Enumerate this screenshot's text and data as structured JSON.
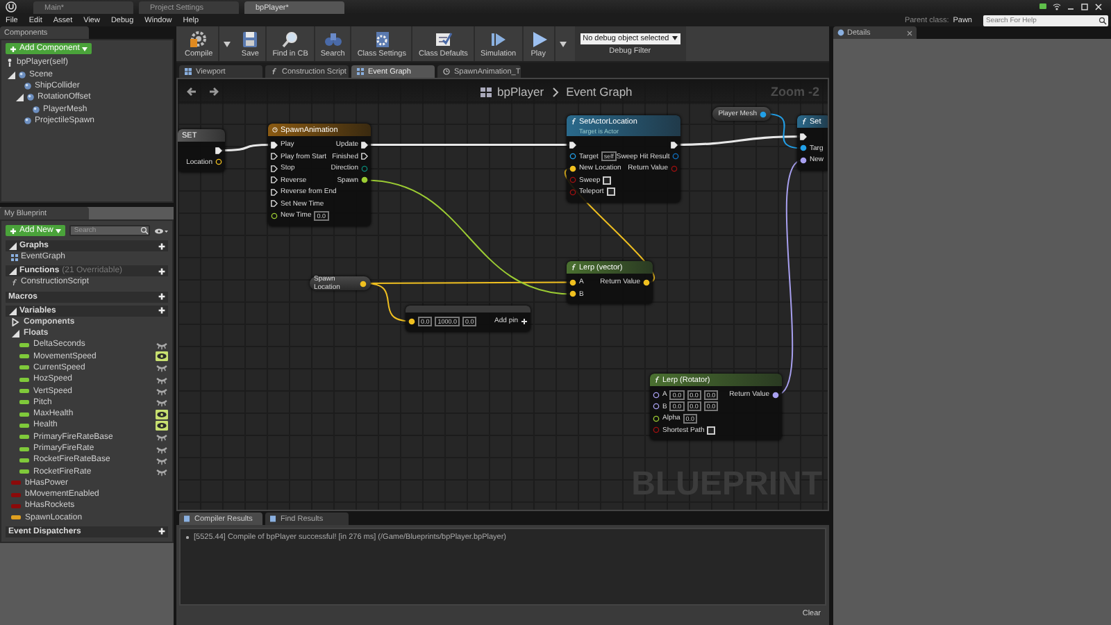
{
  "title_tabs": [
    {
      "label": "Main*",
      "selected": false
    },
    {
      "label": "Project Settings",
      "selected": false
    },
    {
      "label": "bpPlayer*",
      "selected": true
    }
  ],
  "menu": [
    "File",
    "Edit",
    "Asset",
    "View",
    "Debug",
    "Window",
    "Help"
  ],
  "parent_class": {
    "label": "Parent class:",
    "value": "Pawn"
  },
  "help_search": {
    "placeholder": "Search For Help"
  },
  "components_panel": {
    "tab": "Components",
    "add_button": "Add Component",
    "self_item": "bpPlayer(self)",
    "tree": [
      {
        "label": "Scene",
        "expanded": true,
        "children": [
          {
            "label": "ShipCollider"
          },
          {
            "label": "RotationOffset",
            "expanded": true,
            "children": [
              {
                "label": "PlayerMesh"
              }
            ]
          },
          {
            "label": "ProjectileSpawn"
          }
        ]
      }
    ]
  },
  "my_blueprint": {
    "tab": "My Blueprint",
    "add_button": "Add New",
    "search": {
      "placeholder": "Search"
    },
    "sections": [
      {
        "title": "Graphs",
        "expanded": true,
        "items": [
          {
            "label": "EventGraph",
            "kind": "graph"
          }
        ]
      },
      {
        "title": "Functions",
        "note": "(21 Overridable)",
        "expanded": true,
        "items": [
          {
            "label": "ConstructionScript",
            "kind": "function"
          }
        ]
      },
      {
        "title": "Macros"
      },
      {
        "title": "Variables",
        "expanded": true,
        "items": [
          {
            "label": "Components",
            "kind": "category",
            "expanded": false
          },
          {
            "label": "Floats",
            "kind": "category",
            "expanded": true,
            "children": [
              {
                "label": "DeltaSeconds",
                "kind": "variable",
                "color": "#7fc93a",
                "public": false
              },
              {
                "label": "MovementSpeed",
                "kind": "variable",
                "color": "#7fc93a",
                "public": true
              },
              {
                "label": "CurrentSpeed",
                "kind": "variable",
                "color": "#7fc93a",
                "public": false
              },
              {
                "label": "HozSpeed",
                "kind": "variable",
                "color": "#7fc93a",
                "public": false
              },
              {
                "label": "VertSpeed",
                "kind": "variable",
                "color": "#7fc93a",
                "public": false
              },
              {
                "label": "Pitch",
                "kind": "variable",
                "color": "#7fc93a",
                "public": false
              },
              {
                "label": "MaxHealth",
                "kind": "variable",
                "color": "#7fc93a",
                "public": true
              },
              {
                "label": "Health",
                "kind": "variable",
                "color": "#7fc93a",
                "public": true
              },
              {
                "label": "PrimaryFireRateBase",
                "kind": "variable",
                "color": "#7fc93a",
                "public": false
              },
              {
                "label": "PrimaryFireRate",
                "kind": "variable",
                "color": "#7fc93a",
                "public": false
              },
              {
                "label": "RocketFireRateBase",
                "kind": "variable",
                "color": "#7fc93a",
                "public": false
              },
              {
                "label": "RocketFireRate",
                "kind": "variable",
                "color": "#7fc93a",
                "public": false
              }
            ]
          },
          {
            "label": "bHasPower",
            "kind": "variable",
            "color": "#8c0a0a"
          },
          {
            "label": "bMovementEnabled",
            "kind": "variable",
            "color": "#8c0a0a"
          },
          {
            "label": "bHasRockets",
            "kind": "variable",
            "color": "#8c0a0a"
          },
          {
            "label": "SpawnLocation",
            "kind": "variable",
            "color": "#e0a020"
          }
        ]
      },
      {
        "title": "Event Dispatchers"
      }
    ]
  },
  "toolbar": {
    "buttons": [
      {
        "kind": "compile",
        "label": "Compile",
        "dropdown": true
      },
      {
        "kind": "save",
        "label": "Save",
        "dropdown": false
      },
      {
        "kind": "find",
        "label": "Find in CB",
        "dropdown": false
      },
      {
        "kind": "search",
        "label": "Search",
        "dropdown": false
      },
      {
        "kind": "settings",
        "label": "Class Settings",
        "dropdown": false
      },
      {
        "kind": "defaults",
        "label": "Class Defaults",
        "dropdown": false
      },
      {
        "kind": "simulation",
        "label": "Simulation",
        "dropdown": false
      },
      {
        "kind": "play",
        "label": "Play",
        "dropdown": true
      }
    ],
    "debug": {
      "value": "No debug object selected",
      "label": "Debug Filter"
    }
  },
  "editor_tabs": [
    {
      "kind": "viewport",
      "label": "Viewport",
      "selected": false
    },
    {
      "kind": "function",
      "label": "Construction Script",
      "selected": false
    },
    {
      "kind": "graph",
      "label": "Event Graph",
      "selected": true
    },
    {
      "kind": "timeline",
      "label": "SpawnAnimation_T",
      "selected": false
    }
  ],
  "graph": {
    "breadcrumb": [
      "bpPlayer",
      "Event Graph"
    ],
    "zoom": "Zoom -2",
    "corner_text": "BLUEPRINT",
    "nodes": [
      {
        "kind": "set",
        "title": "SET",
        "right": [
          {
            "kind": "exec",
            "connected": true
          },
          {
            "label": "Location",
            "kind": "vector",
            "connected": false
          }
        ]
      },
      {
        "kind": "timeline",
        "title": "SpawnAnimation",
        "left": [
          {
            "label": "Play",
            "kind": "exec",
            "connected": true
          },
          {
            "label": "Play from Start",
            "kind": "exec",
            "connected": false
          },
          {
            "label": "Stop",
            "kind": "exec",
            "connected": false
          },
          {
            "label": "Reverse",
            "kind": "exec",
            "connected": false
          },
          {
            "label": "Reverse from End",
            "kind": "exec",
            "connected": false
          },
          {
            "label": "Set New Time",
            "kind": "exec",
            "connected": false
          },
          {
            "label": "New Time",
            "kind": "float",
            "connected": false,
            "value": "0.0"
          }
        ],
        "right": [
          {
            "label": "Update",
            "kind": "exec",
            "connected": true
          },
          {
            "label": "Finished",
            "kind": "exec",
            "connected": false
          },
          {
            "label": "Direction",
            "kind": "byte",
            "connected": false
          },
          {
            "label": "Spawn",
            "kind": "float",
            "connected": true
          }
        ]
      },
      {
        "kind": "function",
        "title": "SetActorLocation",
        "subtitle": "Target is Actor",
        "left": [
          {
            "kind": "exec",
            "connected": true
          },
          {
            "label": "Target",
            "kind": "object",
            "connected": false,
            "value": "self"
          },
          {
            "label": "New Location",
            "kind": "vector",
            "connected": true
          },
          {
            "label": "Sweep",
            "kind": "bool",
            "connected": false,
            "checked": false
          },
          {
            "label": "Teleport",
            "kind": "bool",
            "connected": false,
            "checked": false
          }
        ],
        "right": [
          {
            "kind": "exec",
            "connected": true
          },
          {
            "label": "Sweep Hit Result",
            "kind": "struct",
            "connected": false
          },
          {
            "label": "Return Value",
            "kind": "bool",
            "connected": false
          }
        ]
      },
      {
        "kind": "getter",
        "title": "Player Mesh",
        "right": [
          {
            "kind": "object",
            "connected": true
          }
        ]
      },
      {
        "kind": "function",
        "title": "Set",
        "left": [
          {
            "kind": "exec",
            "connected": true
          },
          {
            "label": "Targ",
            "kind": "object",
            "connected": true
          },
          {
            "label": "New",
            "kind": "rotator",
            "connected": true
          }
        ]
      },
      {
        "kind": "getter",
        "title": "Spawn Location",
        "right": [
          {
            "kind": "vector",
            "connected": true
          }
        ]
      },
      {
        "kind": "pure_function",
        "title": "Lerp (vector)",
        "left": [
          {
            "label": "A",
            "kind": "vector",
            "connected": true
          },
          {
            "label": "B",
            "kind": "vector",
            "connected": true
          }
        ],
        "right": [
          {
            "label": "Return Value",
            "kind": "vector",
            "connected": true
          }
        ]
      },
      {
        "kind": "add",
        "left": [
          {
            "kind": "vector",
            "connected": true,
            "values": [
              "0.0",
              "1000.0",
              "0.0"
            ]
          }
        ],
        "add_pin": "Add pin"
      },
      {
        "kind": "pure_function",
        "title": "Lerp (Rotator)",
        "left": [
          {
            "label": "A",
            "kind": "rotator",
            "connected": false,
            "values": [
              "0.0",
              "0.0",
              "0.0"
            ]
          },
          {
            "label": "B",
            "kind": "rotator",
            "connected": false,
            "values": [
              "0.0",
              "0.0",
              "0.0"
            ]
          },
          {
            "label": "Alpha",
            "kind": "float",
            "connected": false,
            "value": "0.0"
          },
          {
            "label": "Shortest Path",
            "kind": "bool",
            "connected": false,
            "checked": false
          }
        ],
        "right": [
          {
            "label": "Return Value",
            "kind": "rotator",
            "connected": true
          }
        ]
      }
    ]
  },
  "log": {
    "tabs": [
      {
        "label": "Compiler Results",
        "selected": true
      },
      {
        "label": "Find Results",
        "selected": false
      }
    ],
    "messages": [
      "[5525.44] Compile of bpPlayer successful! [in 276 ms] (/Game/Blueprints/bpPlayer.bpPlayer)"
    ],
    "clear_button": "Clear"
  },
  "details": {
    "tab": "Details"
  }
}
